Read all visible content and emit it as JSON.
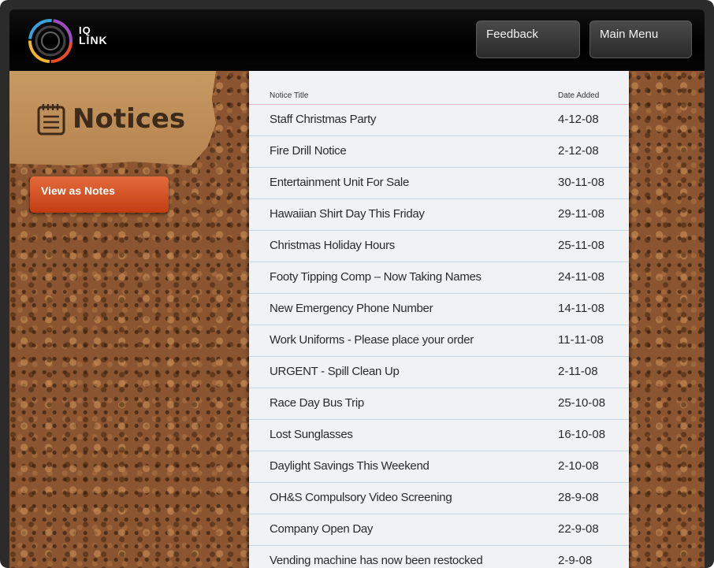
{
  "header": {
    "logo_top": "IQ",
    "logo_bottom": "LINK",
    "feedback_label": "Feedback",
    "main_menu_label": "Main Menu"
  },
  "sidebar": {
    "title": "Notices",
    "view_as_notes_label": "View as Notes"
  },
  "table": {
    "col_title": "Notice Title",
    "col_date": "Date Added",
    "rows": [
      {
        "title": "Staff Christmas Party",
        "date": "4-12-08"
      },
      {
        "title": "Fire Drill Notice",
        "date": "2-12-08"
      },
      {
        "title": "Entertainment Unit For Sale",
        "date": "30-11-08"
      },
      {
        "title": "Hawaiian Shirt Day This Friday",
        "date": "29-11-08"
      },
      {
        "title": "Christmas Holiday Hours",
        "date": "25-11-08"
      },
      {
        "title": "Footy Tipping Comp – Now Taking Names",
        "date": "24-11-08"
      },
      {
        "title": "New Emergency Phone Number",
        "date": "14-11-08"
      },
      {
        "title": "Work Uniforms - Please place your order",
        "date": "11-11-08"
      },
      {
        "title": "URGENT - Spill Clean Up",
        "date": "2-11-08"
      },
      {
        "title": "Race Day Bus Trip",
        "date": "25-10-08"
      },
      {
        "title": "Lost Sunglasses",
        "date": "16-10-08"
      },
      {
        "title": "Daylight Savings This Weekend",
        "date": "2-10-08"
      },
      {
        "title": "OH&S Compulsory Video Screening",
        "date": "28-9-08"
      },
      {
        "title": "Company Open Day",
        "date": "22-9-08"
      },
      {
        "title": "Vending machine has now been restocked",
        "date": "2-9-08"
      }
    ]
  },
  "colors": {
    "accent_button": "#d3511f",
    "cork": "#8a5530",
    "paper": "#f1f2f4",
    "topbar": "#000000"
  }
}
